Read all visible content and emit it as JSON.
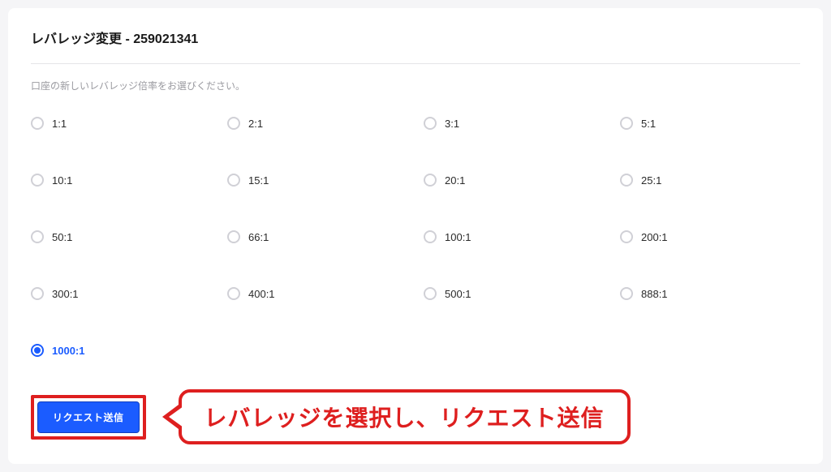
{
  "header": {
    "title": "レバレッジ変更 - 259021341"
  },
  "description": "口座の新しいレバレッジ倍率をお選びください。",
  "options": [
    {
      "label": "1:1",
      "selected": false
    },
    {
      "label": "2:1",
      "selected": false
    },
    {
      "label": "3:1",
      "selected": false
    },
    {
      "label": "5:1",
      "selected": false
    },
    {
      "label": "10:1",
      "selected": false
    },
    {
      "label": "15:1",
      "selected": false
    },
    {
      "label": "20:1",
      "selected": false
    },
    {
      "label": "25:1",
      "selected": false
    },
    {
      "label": "50:1",
      "selected": false
    },
    {
      "label": "66:1",
      "selected": false
    },
    {
      "label": "100:1",
      "selected": false
    },
    {
      "label": "200:1",
      "selected": false
    },
    {
      "label": "300:1",
      "selected": false
    },
    {
      "label": "400:1",
      "selected": false
    },
    {
      "label": "500:1",
      "selected": false
    },
    {
      "label": "888:1",
      "selected": false
    },
    {
      "label": "1000:1",
      "selected": true
    }
  ],
  "actions": {
    "submit_label": "リクエスト送信"
  },
  "annotation": {
    "text": "レバレッジを選択し、リクエスト送信"
  }
}
